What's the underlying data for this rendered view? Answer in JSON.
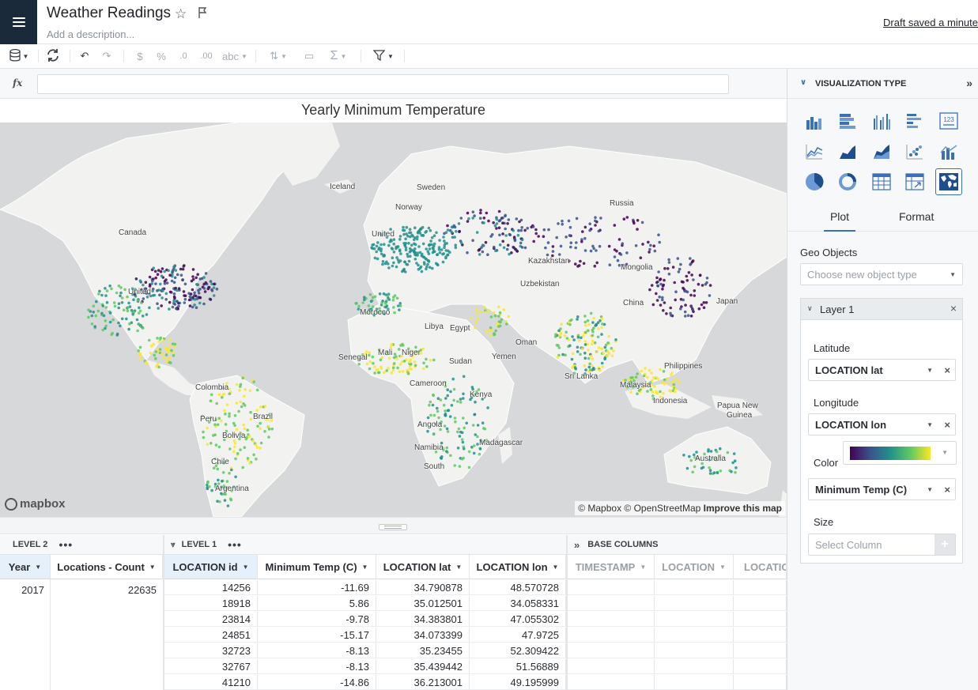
{
  "header": {
    "title": "Weather Readings",
    "description_placeholder": "Add a description...",
    "draft_status": "Draft saved a minute"
  },
  "toolbar": {
    "currency_label": "$",
    "percent_label": "%",
    "decrease_decimal_label": ".0",
    "increase_decimal_label": ".00",
    "format_label": "abc"
  },
  "formula": {
    "fx_label": "fx"
  },
  "chart": {
    "title": "Yearly Minimum Temperature",
    "map_labels": [
      {
        "text": "Iceland"
      },
      {
        "text": "Sweden"
      },
      {
        "text": "Norway"
      },
      {
        "text": "Russia"
      },
      {
        "text": "Canada"
      },
      {
        "text": "United"
      },
      {
        "text": "Kazakhstan"
      },
      {
        "text": "Mongolia"
      },
      {
        "text": "Uzbekistan"
      },
      {
        "text": "United"
      },
      {
        "text": "China"
      },
      {
        "text": "Japan"
      },
      {
        "text": "Morocco"
      },
      {
        "text": "Libya"
      },
      {
        "text": "Egypt"
      },
      {
        "text": "Oman"
      },
      {
        "text": "Mali"
      },
      {
        "text": "Niger"
      },
      {
        "text": "Yemen"
      },
      {
        "text": "Senegal"
      },
      {
        "text": "Sudan"
      },
      {
        "text": "Sri Lanka"
      },
      {
        "text": "Philippines"
      },
      {
        "text": "Colombia"
      },
      {
        "text": "Cameroon"
      },
      {
        "text": "Kenya"
      },
      {
        "text": "Malaysia"
      },
      {
        "text": "Peru"
      },
      {
        "text": "Brazil"
      },
      {
        "text": "Indonesia"
      },
      {
        "text": "Papua New"
      },
      {
        "text": "Guinea"
      },
      {
        "text": "Angola"
      },
      {
        "text": "Bolivia"
      },
      {
        "text": "Namibia"
      },
      {
        "text": "Madagascar"
      },
      {
        "text": "Australia"
      },
      {
        "text": "Chile"
      },
      {
        "text": "South"
      },
      {
        "text": "Argentina"
      }
    ],
    "mapbox_logo": "mapbox",
    "attribution_1": "© Mapbox © OpenStreetMap",
    "attribution_2": "Improve this map",
    "colors": [
      "#440154",
      "#3b528b",
      "#21918c",
      "#5ec962",
      "#fde725"
    ]
  },
  "table": {
    "level2": {
      "label": "LEVEL 2",
      "columns": [
        "Year",
        "Locations - Count"
      ],
      "rows": [
        [
          "2017",
          "22635"
        ]
      ]
    },
    "level1": {
      "label": "LEVEL 1",
      "columns": [
        "LOCATION id",
        "Minimum Temp (C)",
        "LOCATION lat",
        "LOCATION lon"
      ],
      "rows": [
        [
          "14256",
          "-11.69",
          "34.790878",
          "48.570728"
        ],
        [
          "18918",
          "5.86",
          "35.012501",
          "34.058331"
        ],
        [
          "23814",
          "-9.78",
          "34.383801",
          "47.055302"
        ],
        [
          "24851",
          "-15.17",
          "34.073399",
          "47.9725"
        ],
        [
          "32723",
          "-8.13",
          "35.23455",
          "52.309422"
        ],
        [
          "32767",
          "-8.13",
          "35.439442",
          "51.56889"
        ],
        [
          "41210",
          "-14.86",
          "36.213001",
          "49.195999"
        ]
      ]
    },
    "base": {
      "label": "BASE COLUMNS",
      "columns": [
        "TIMESTAMP",
        "LOCATION",
        "LOCATIO"
      ]
    }
  },
  "panel": {
    "viz_type_label": "VISUALIZATION TYPE",
    "tabs": [
      "Plot",
      "Format"
    ],
    "geo_objects_label": "Geo Objects",
    "geo_objects_placeholder": "Choose new object type",
    "layer_label": "Layer 1",
    "latitude_label": "Latitude",
    "latitude_value": "LOCATION lat",
    "longitude_label": "Longitude",
    "longitude_value": "LOCATION lon",
    "color_label": "Color",
    "color_value": "Minimum Temp (C)",
    "size_label": "Size",
    "size_placeholder": "Select Column",
    "kpi_icon_text": "123"
  }
}
